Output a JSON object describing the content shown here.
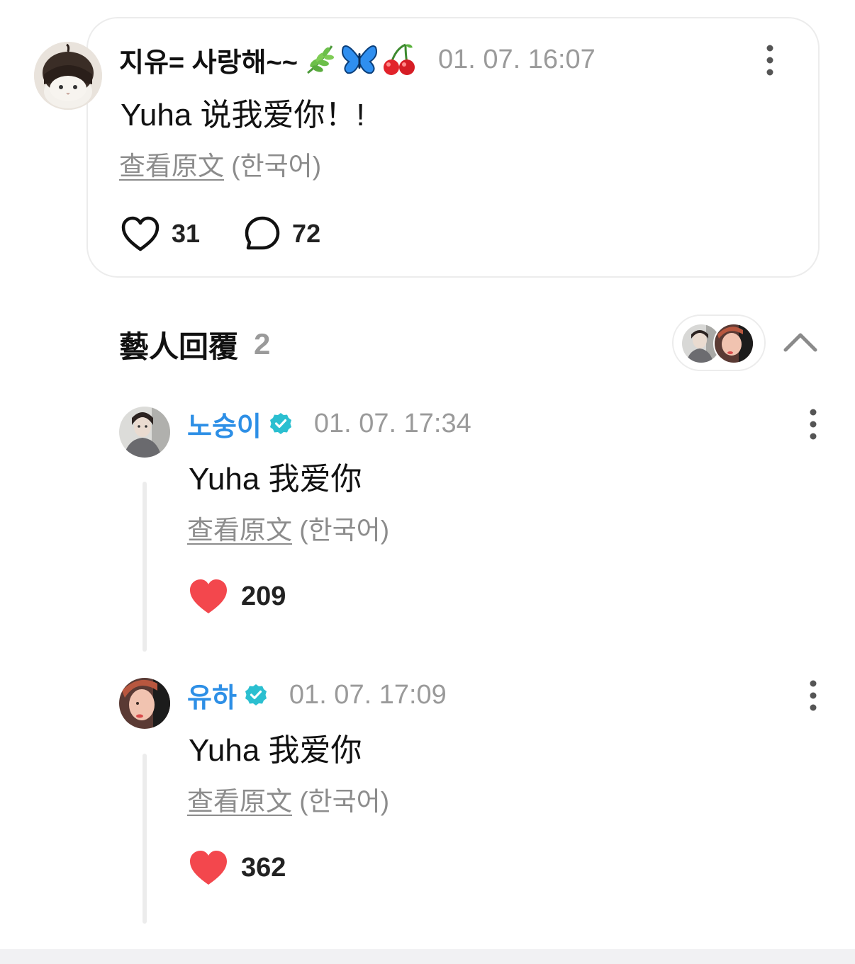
{
  "post": {
    "author": "지유= 사랑해~~",
    "emojis": [
      "herb-icon",
      "butterfly-icon",
      "cherries-icon"
    ],
    "timestamp": "01. 07. 16:07",
    "body": "Yuha 说我爱你！!",
    "translate_link": "查看原文",
    "translate_lang": "(한국어)",
    "likes": "31",
    "comments": "72"
  },
  "artist_replies": {
    "label": "藝人回覆",
    "count": "2"
  },
  "replies": [
    {
      "name": "노숭이",
      "timestamp": "01. 07. 17:34",
      "body": "Yuha 我爱你",
      "translate_link": "查看原文",
      "translate_lang": "(한국어)",
      "likes": "209"
    },
    {
      "name": "유하",
      "timestamp": "01. 07. 17:09",
      "body": "Yuha 我爱你",
      "translate_link": "查看原文",
      "translate_lang": "(한국어)",
      "likes": "362"
    }
  ],
  "colors": {
    "artist_name": "#2d8fe6",
    "verified_badge": "#2bbfd0",
    "like_filled": "#f3474d",
    "muted_text": "#9a9a9a",
    "card_border": "#ececec"
  }
}
